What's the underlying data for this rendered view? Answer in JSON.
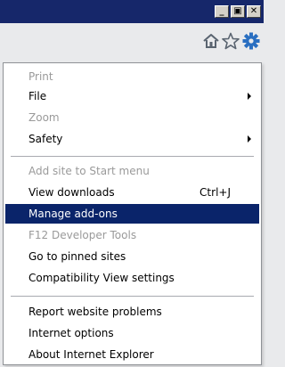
{
  "window": {
    "minimize_glyph": "_",
    "maximize_glyph": "▣",
    "close_glyph": "✕"
  },
  "toolbar": {
    "icons": [
      "home-icon",
      "favorites-star-icon",
      "tools-gear-icon"
    ],
    "accent": "#2a6fc1"
  },
  "menu": {
    "items": [
      {
        "label": "Print",
        "enabled": false,
        "submenu": false
      },
      {
        "label": "File",
        "enabled": true,
        "submenu": true
      },
      {
        "label": "Zoom",
        "enabled": false,
        "submenu": false
      },
      {
        "label": "Safety",
        "enabled": true,
        "submenu": true
      },
      {
        "label": "Add site to Start menu",
        "enabled": false
      },
      {
        "label": "View downloads",
        "enabled": true,
        "shortcut": "Ctrl+J"
      },
      {
        "label": "Manage add-ons",
        "enabled": true,
        "selected": true
      },
      {
        "label": "F12 Developer Tools",
        "enabled": false
      },
      {
        "label": "Go to pinned sites",
        "enabled": true
      },
      {
        "label": "Compatibility View settings",
        "enabled": true
      },
      {
        "label": "Report website problems",
        "enabled": true
      },
      {
        "label": "Internet options",
        "enabled": true
      },
      {
        "label": "About Internet Explorer",
        "enabled": true
      }
    ]
  },
  "colors": {
    "titlebar": "#16276a",
    "highlight": "#0a246a",
    "disabled_text": "#9a9a9a"
  }
}
